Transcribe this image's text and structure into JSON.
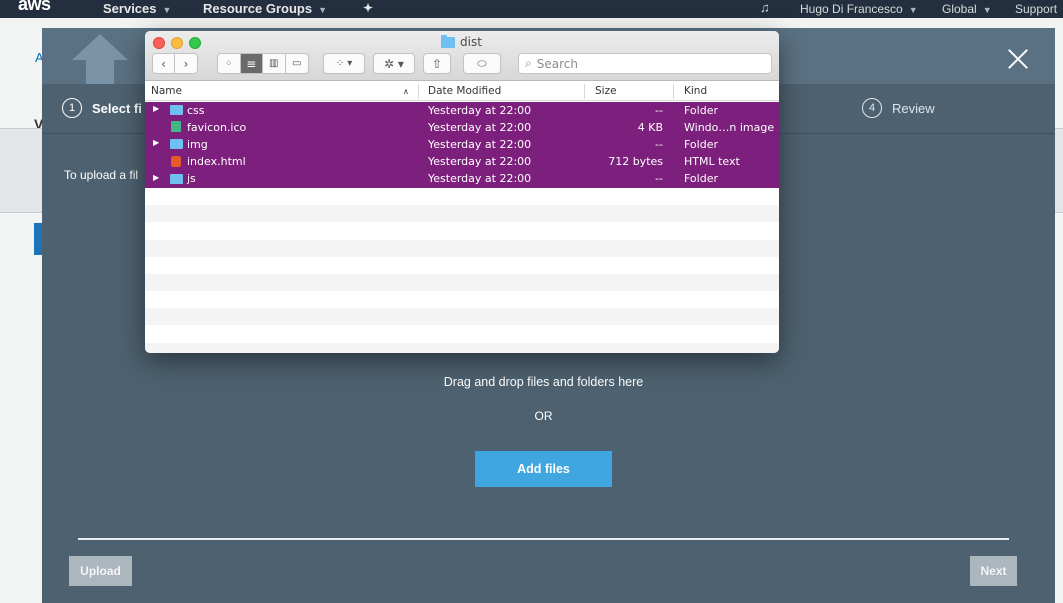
{
  "topnav": {
    "logo": "aws",
    "services": "Services",
    "resource_groups": "Resource Groups",
    "user": "Hugo Di Francesco",
    "region": "Global",
    "support": "Support"
  },
  "background": {
    "a_char": "A",
    "v_char": "V"
  },
  "modal": {
    "steps": [
      {
        "num": "1",
        "label": "Select fi"
      },
      {
        "num": "4",
        "label": "Review"
      }
    ],
    "upload_info": "To upload a fil",
    "drag_text": "Drag and drop files and folders here",
    "or_text": "OR",
    "add_files": "Add files",
    "upload_button": "Upload",
    "next_button": "Next"
  },
  "finder": {
    "title": "dist",
    "search_placeholder": "Search",
    "columns": {
      "name": "Name",
      "date": "Date Modified",
      "size": "Size",
      "kind": "Kind"
    },
    "files": [
      {
        "name": "css",
        "date": "Yesterday at 22:00",
        "size": "--",
        "kind": "Folder",
        "icon": "folder-icon"
      },
      {
        "name": "favicon.ico",
        "date": "Yesterday at 22:00",
        "size": "4 KB",
        "kind": "Windo…n image",
        "icon": "favicon-icon"
      },
      {
        "name": "img",
        "date": "Yesterday at 22:00",
        "size": "--",
        "kind": "Folder",
        "icon": "folder-icon"
      },
      {
        "name": "index.html",
        "date": "Yesterday at 22:00",
        "size": "712 bytes",
        "kind": "HTML text",
        "icon": "html-file-icon"
      },
      {
        "name": "js",
        "date": "Yesterday at 22:00",
        "size": "--",
        "kind": "Folder",
        "icon": "folder-icon"
      }
    ],
    "selection_color": "#7d1f7c"
  }
}
